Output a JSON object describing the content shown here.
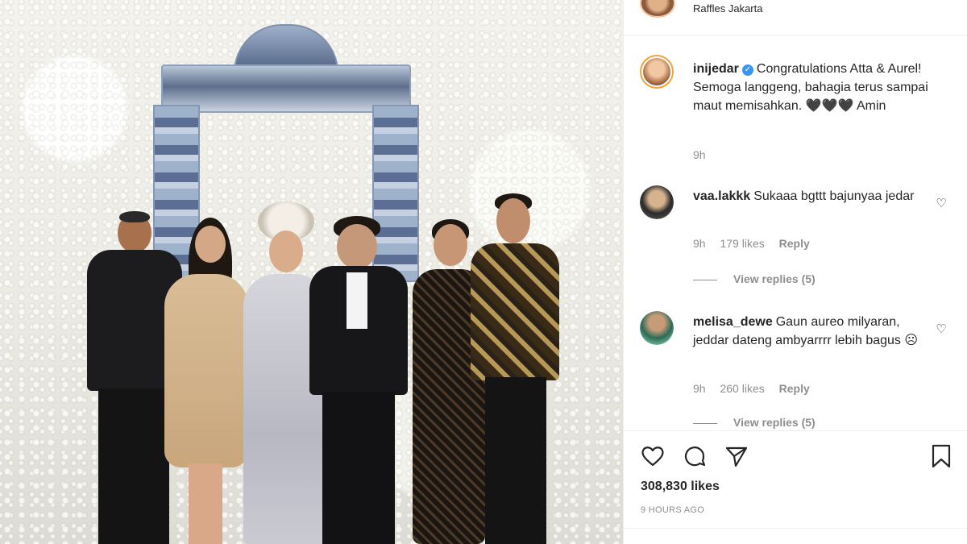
{
  "header": {
    "location": "Raffles Jakarta"
  },
  "caption": {
    "username": "inijedar",
    "verified": true,
    "text": "Congratulations Atta & Aurel! Semoga langgeng, bahagia terus sampai maut memisahkan. 🖤🖤🖤 Amin",
    "time": "9h"
  },
  "comments": [
    {
      "username": "vaa.lakkk",
      "text": "Sukaaa bgttt bajunyaa jedar",
      "time": "9h",
      "likes": "179 likes",
      "reply_label": "Reply",
      "view_replies": "View replies (5)"
    },
    {
      "username": "melisa_dewe",
      "text": "Gaun aureo milyaran, jeddar dateng ambyarrrr lebih bagus ☹",
      "time": "9h",
      "likes": "260 likes",
      "reply_label": "Reply",
      "view_replies": "View replies (5)"
    }
  ],
  "post": {
    "likes": "308,830 likes",
    "timestamp": "9 HOURS AGO"
  },
  "icons": {
    "like": "heart-icon",
    "comment": "comment-icon",
    "share": "paper-plane-icon",
    "save": "bookmark-icon"
  },
  "colors": {
    "text": "#262626",
    "muted": "#8e8e8e",
    "verified": "#3897f0",
    "border": "#efefef"
  }
}
